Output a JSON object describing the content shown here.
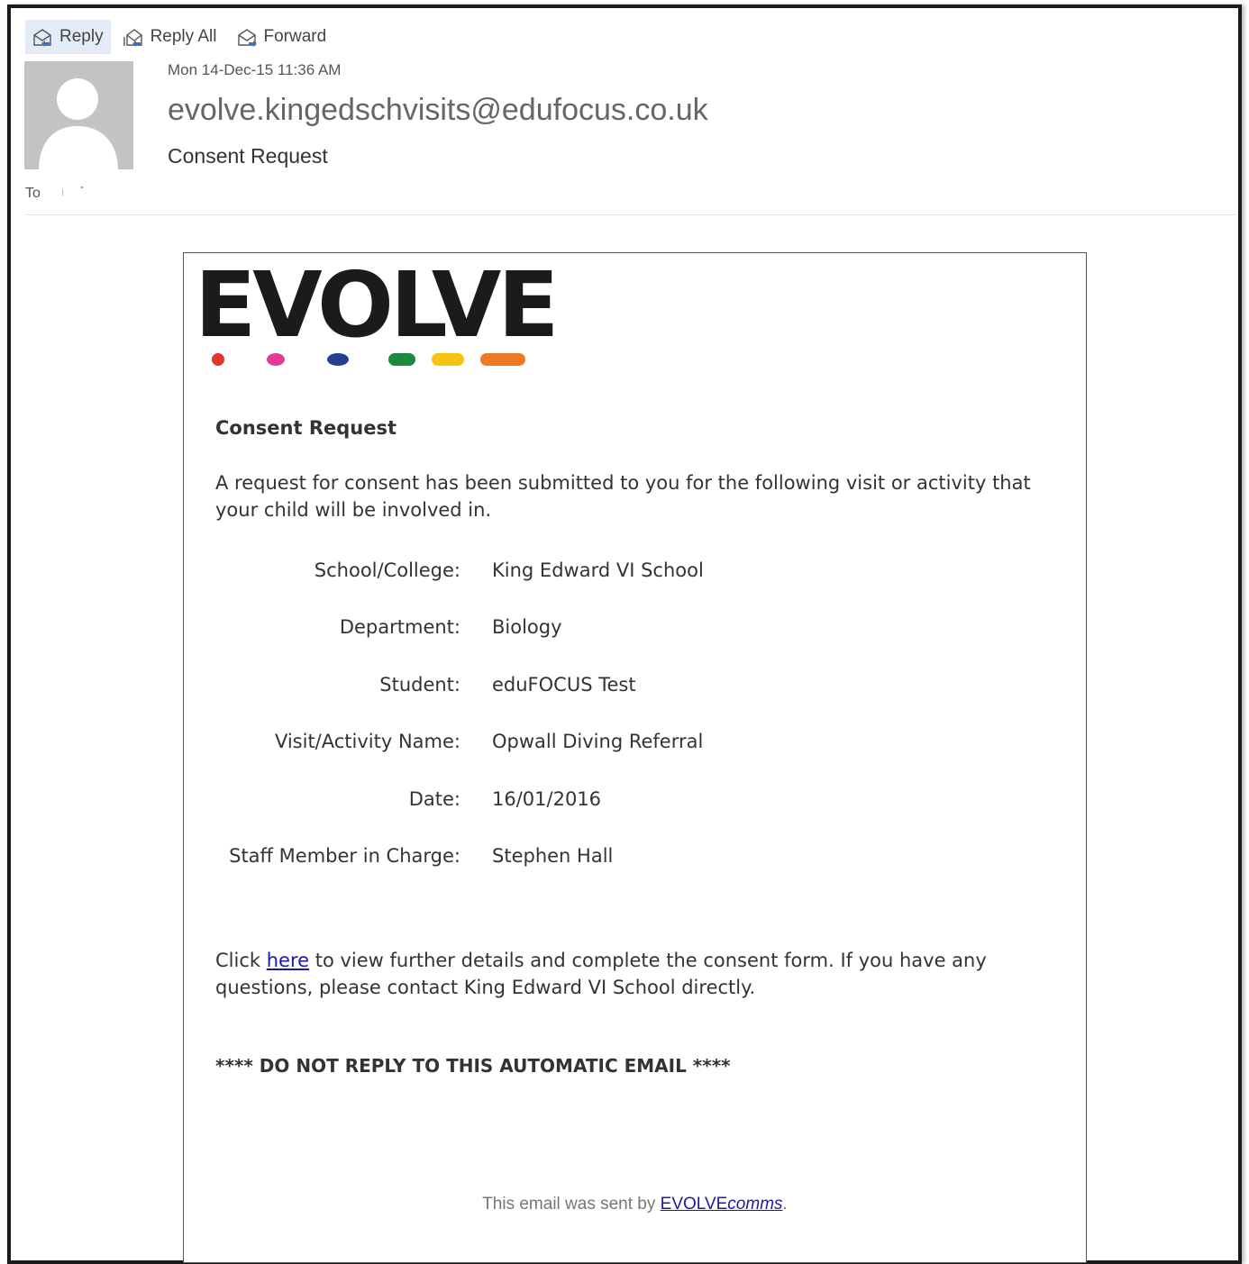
{
  "toolbar": {
    "reply_label": "Reply",
    "reply_all_label": "Reply All",
    "forward_label": "Forward"
  },
  "header": {
    "date": "Mon 14-Dec-15 11:36 AM",
    "from": "evolve.kingedschvisits@edufocus.co.uk",
    "subject": "Consent Request",
    "to_label": "To"
  },
  "body": {
    "logo_text": "EVOLVE",
    "logo_dot_colors": [
      "#e2362b",
      "#e23a9b",
      "#233f8f",
      "#1c8a3e",
      "#f7c313",
      "#ee7a26"
    ],
    "title": "Consent Request",
    "intro": "A request for consent has been submitted to you for the following visit or activity that your child will be involved in.",
    "details": [
      {
        "label": "School/College:",
        "value": "King Edward VI School"
      },
      {
        "label": "Department:",
        "value": "Biology"
      },
      {
        "label": "Student:",
        "value": "eduFOCUS Test"
      },
      {
        "label": "Visit/Activity Name:",
        "value": "Opwall Diving Referral"
      },
      {
        "label": "Date:",
        "value": "16/01/2016"
      },
      {
        "label": "Staff Member in Charge:",
        "value": "Stephen Hall"
      }
    ],
    "click_prefix": "Click ",
    "click_link": "here",
    "click_suffix": " to view further details and complete the consent form. If you have any questions, please contact King Edward VI School directly.",
    "warning": "**** DO NOT REPLY TO THIS AUTOMATIC EMAIL ****",
    "footer_prefix": "This email was sent by ",
    "footer_link_a": "EVOLVE",
    "footer_link_b": "comms",
    "footer_suffix": "."
  },
  "icons": {
    "reply": "reply-icon",
    "reply_all": "reply-all-icon",
    "forward": "forward-icon",
    "avatar": "person-silhouette-icon"
  }
}
